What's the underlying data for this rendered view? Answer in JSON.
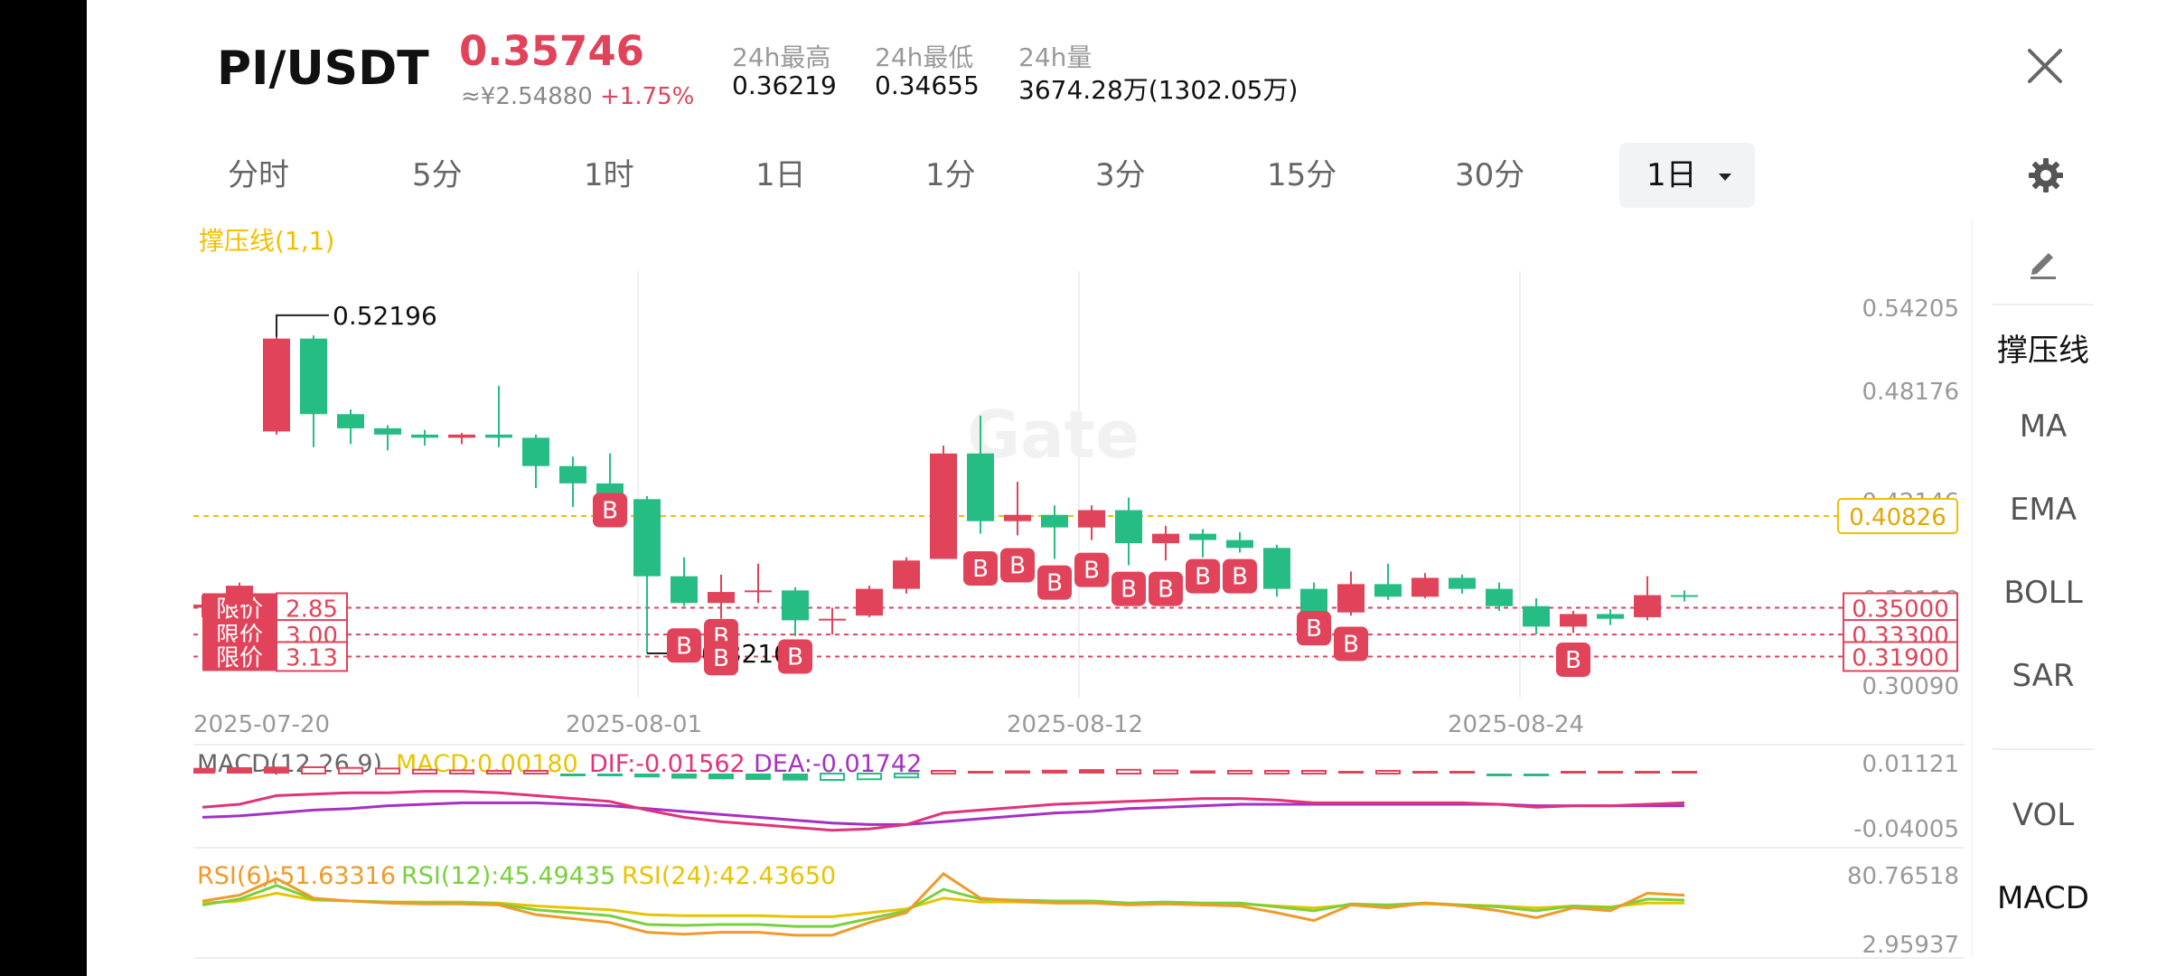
{
  "header": {
    "pair": "PI/USDT",
    "price": "0.35746",
    "cny_price": "≈¥2.54880",
    "change": "+1.75%",
    "high_label": "24h最高",
    "high_value": "0.36219",
    "low_label": "24h最低",
    "low_value": "0.34655",
    "vol_label": "24h量",
    "vol_value": "3674.28万(1302.05万)"
  },
  "tabs": [
    {
      "label": "分时"
    },
    {
      "label": "5分"
    },
    {
      "label": "1时"
    },
    {
      "label": "1日"
    },
    {
      "label": "1分"
    },
    {
      "label": "3分"
    },
    {
      "label": "15分"
    },
    {
      "label": "30分"
    },
    {
      "label": "1日",
      "active": true
    }
  ],
  "sidebar": {
    "items": [
      "撑压线",
      "MA",
      "EMA",
      "BOLL",
      "SAR",
      "VOL",
      "MACD"
    ]
  },
  "icons": [
    "close-icon",
    "gear-icon",
    "pencil-icon",
    "chevron-down-icon"
  ],
  "colors": {
    "up": "#e0435a",
    "down": "#26bd85",
    "sr_line": "#f0c000",
    "dif": "#e0337a",
    "dea": "#a630c4",
    "rsi6": "#f09a28",
    "rsi12": "#79d03c",
    "rsi24": "#e8c400"
  },
  "chart_data": {
    "type": "candlestick",
    "indicator_title": "撑压线(1,1)",
    "y_ticks": [
      "0.54205",
      "0.48176",
      "0.42146",
      "0.36118",
      "0.30090"
    ],
    "x_ticks": [
      "2025-07-20",
      "2025-08-01",
      "2025-08-12",
      "2025-08-24"
    ],
    "ohlc": [
      [
        0.35,
        0.358,
        0.344,
        0.352
      ],
      [
        0.352,
        0.366,
        0.346,
        0.364
      ],
      [
        0.462,
        0.522,
        0.46,
        0.521
      ],
      [
        0.521,
        0.523,
        0.452,
        0.473
      ],
      [
        0.473,
        0.476,
        0.454,
        0.464
      ],
      [
        0.464,
        0.466,
        0.45,
        0.46
      ],
      [
        0.46,
        0.463,
        0.453,
        0.458
      ],
      [
        0.458,
        0.461,
        0.454,
        0.46
      ],
      [
        0.46,
        0.491,
        0.452,
        0.458
      ],
      [
        0.458,
        0.46,
        0.426,
        0.44
      ],
      [
        0.44,
        0.446,
        0.414,
        0.429
      ],
      [
        0.429,
        0.448,
        0.416,
        0.419
      ],
      [
        0.419,
        0.421,
        0.321,
        0.37
      ],
      [
        0.37,
        0.382,
        0.351,
        0.353
      ],
      [
        0.353,
        0.371,
        0.343,
        0.36
      ],
      [
        0.36,
        0.378,
        0.353,
        0.361
      ],
      [
        0.361,
        0.363,
        0.332,
        0.342
      ],
      [
        0.342,
        0.35,
        0.333,
        0.343
      ],
      [
        0.345,
        0.364,
        0.344,
        0.362
      ],
      [
        0.362,
        0.382,
        0.359,
        0.38
      ],
      [
        0.381,
        0.453,
        0.381,
        0.448
      ],
      [
        0.448,
        0.472,
        0.397,
        0.405
      ],
      [
        0.405,
        0.43,
        0.396,
        0.409
      ],
      [
        0.409,
        0.415,
        0.381,
        0.401
      ],
      [
        0.401,
        0.415,
        0.393,
        0.412
      ],
      [
        0.412,
        0.42,
        0.377,
        0.391
      ],
      [
        0.391,
        0.402,
        0.38,
        0.397
      ],
      [
        0.397,
        0.4,
        0.382,
        0.393
      ],
      [
        0.393,
        0.398,
        0.385,
        0.388
      ],
      [
        0.388,
        0.39,
        0.357,
        0.362
      ],
      [
        0.362,
        0.366,
        0.343,
        0.347
      ],
      [
        0.347,
        0.373,
        0.345,
        0.365
      ],
      [
        0.365,
        0.378,
        0.355,
        0.357
      ],
      [
        0.357,
        0.372,
        0.356,
        0.369
      ],
      [
        0.369,
        0.371,
        0.359,
        0.362
      ],
      [
        0.362,
        0.366,
        0.348,
        0.351
      ],
      [
        0.351,
        0.356,
        0.333,
        0.338
      ],
      [
        0.338,
        0.348,
        0.334,
        0.346
      ],
      [
        0.346,
        0.349,
        0.339,
        0.343
      ],
      [
        0.344,
        0.37,
        0.342,
        0.358
      ],
      [
        0.358,
        0.361,
        0.354,
        0.357
      ]
    ],
    "annotations": {
      "high": "0.52196",
      "low": "0.32100",
      "support_resistance": "0.40826"
    },
    "price_lines": [
      {
        "label": "限价",
        "value": "2.85",
        "price": "0.35000"
      },
      {
        "label": "限价",
        "value": "3.00",
        "price": "0.33300"
      },
      {
        "label": "限价",
        "value": "3.13",
        "price": "0.31900"
      }
    ],
    "buy_marker_label": "B",
    "macd": {
      "title": "MACD(12,26,9)",
      "macd_label": "MACD:0.00180",
      "dif_label": "DIF:-0.01562",
      "dea_label": "DEA:-0.01742",
      "y_ticks": [
        "0.01121",
        "-0.04005"
      ],
      "hist": [
        0.009,
        0.01,
        0.011,
        0.01,
        0.009,
        0.008,
        0.006,
        0.005,
        0.003,
        0.001,
        -0.001,
        -0.003,
        -0.006,
        -0.008,
        -0.009,
        -0.01,
        -0.011,
        -0.01,
        -0.009,
        -0.006,
        0.002,
        0.004,
        0.005,
        0.006,
        0.007,
        0.006,
        0.005,
        0.005,
        0.004,
        0.002,
        0.001,
        0.001,
        0.0,
        0.0,
        0.0,
        -0.001,
        -0.001,
        0.001,
        0.001,
        0.002,
        0.002
      ],
      "dif": [
        -0.018,
        -0.016,
        -0.01,
        -0.009,
        -0.008,
        -0.008,
        -0.007,
        -0.007,
        -0.008,
        -0.01,
        -0.012,
        -0.014,
        -0.02,
        -0.025,
        -0.028,
        -0.03,
        -0.032,
        -0.034,
        -0.033,
        -0.03,
        -0.022,
        -0.02,
        -0.018,
        -0.016,
        -0.015,
        -0.014,
        -0.013,
        -0.012,
        -0.012,
        -0.013,
        -0.015,
        -0.015,
        -0.015,
        -0.015,
        -0.015,
        -0.016,
        -0.018,
        -0.017,
        -0.017,
        -0.016,
        -0.015
      ],
      "dea": [
        -0.025,
        -0.024,
        -0.022,
        -0.02,
        -0.019,
        -0.017,
        -0.016,
        -0.015,
        -0.015,
        -0.015,
        -0.016,
        -0.017,
        -0.019,
        -0.021,
        -0.023,
        -0.025,
        -0.027,
        -0.029,
        -0.03,
        -0.03,
        -0.028,
        -0.026,
        -0.024,
        -0.022,
        -0.021,
        -0.019,
        -0.018,
        -0.017,
        -0.016,
        -0.016,
        -0.016,
        -0.016,
        -0.016,
        -0.016,
        -0.016,
        -0.016,
        -0.017,
        -0.017,
        -0.017,
        -0.017,
        -0.017
      ]
    },
    "rsi": {
      "rsi6_label": "RSI(6):51.63316",
      "rsi12_label": "RSI(12):45.49435",
      "rsi24_label": "RSI(24):42.43650",
      "y_ticks": [
        "80.76518",
        "2.95937"
      ],
      "rsi6": [
        52,
        58,
        75,
        55,
        52,
        50,
        49,
        49,
        48,
        38,
        34,
        30,
        20,
        18,
        20,
        20,
        17,
        17,
        30,
        40,
        80,
        55,
        52,
        50,
        50,
        48,
        49,
        48,
        47,
        40,
        32,
        48,
        45,
        50,
        47,
        42,
        35,
        45,
        42,
        60,
        58
      ],
      "rsi12": [
        48,
        54,
        68,
        54,
        52,
        51,
        50,
        50,
        49,
        43,
        40,
        37,
        28,
        27,
        28,
        28,
        26,
        26,
        34,
        42,
        64,
        54,
        53,
        52,
        52,
        50,
        51,
        50,
        50,
        46,
        42,
        49,
        48,
        50,
        48,
        46,
        42,
        47,
        45,
        54,
        53
      ],
      "rsi24": [
        50,
        52,
        60,
        53,
        52,
        51,
        51,
        51,
        50,
        47,
        45,
        43,
        38,
        37,
        37,
        37,
        36,
        36,
        40,
        44,
        55,
        51,
        51,
        50,
        50,
        49,
        50,
        49,
        49,
        47,
        45,
        48,
        48,
        49,
        48,
        47,
        45,
        47,
        46,
        50,
        50
      ]
    }
  }
}
